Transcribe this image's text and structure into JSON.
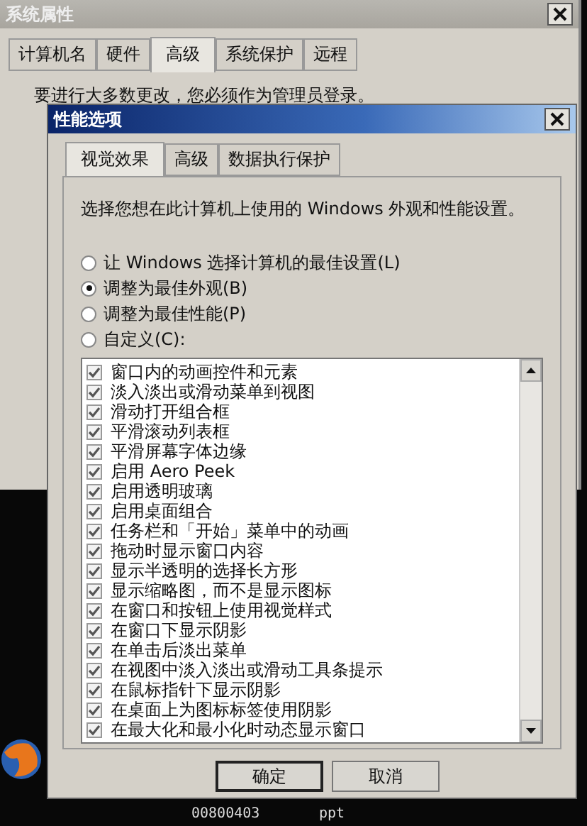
{
  "back_window": {
    "title": "系统属性",
    "tabs": [
      {
        "label": "计算机名",
        "selected": false
      },
      {
        "label": "硬件",
        "selected": false
      },
      {
        "label": "高级",
        "selected": true
      },
      {
        "label": "系统保护",
        "selected": false
      },
      {
        "label": "远程",
        "selected": false
      }
    ],
    "message": "要进行大多数更改，您必须作为管理员登录。"
  },
  "dialog": {
    "title": "性能选项",
    "tabs": [
      {
        "label": "视觉效果",
        "selected": true
      },
      {
        "label": "高级",
        "selected": false
      },
      {
        "label": "数据执行保护",
        "selected": false
      }
    ],
    "description": "选择您想在此计算机上使用的 Windows 外观和性能设置。",
    "options": [
      {
        "label": "让 Windows 选择计算机的最佳设置(L)",
        "selected": false
      },
      {
        "label": "调整为最佳外观(B)",
        "selected": true
      },
      {
        "label": "调整为最佳性能(P)",
        "selected": false
      },
      {
        "label": "自定义(C):",
        "selected": false
      }
    ],
    "effects": [
      {
        "label": "窗口内的动画控件和元素",
        "checked": true
      },
      {
        "label": "淡入淡出或滑动菜单到视图",
        "checked": true
      },
      {
        "label": "滑动打开组合框",
        "checked": true
      },
      {
        "label": "平滑滚动列表框",
        "checked": true
      },
      {
        "label": "平滑屏幕字体边缘",
        "checked": true
      },
      {
        "label": "启用 Aero Peek",
        "checked": true
      },
      {
        "label": "启用透明玻璃",
        "checked": true
      },
      {
        "label": "启用桌面组合",
        "checked": true
      },
      {
        "label": "任务栏和「开始」菜单中的动画",
        "checked": true
      },
      {
        "label": "拖动时显示窗口内容",
        "checked": true
      },
      {
        "label": "显示半透明的选择长方形",
        "checked": true
      },
      {
        "label": "显示缩略图，而不是显示图标",
        "checked": true
      },
      {
        "label": "在窗口和按钮上使用视觉样式",
        "checked": true
      },
      {
        "label": "在窗口下显示阴影",
        "checked": true
      },
      {
        "label": "在单击后淡出菜单",
        "checked": true
      },
      {
        "label": "在视图中淡入淡出或滑动工具条提示",
        "checked": true
      },
      {
        "label": "在鼠标指针下显示阴影",
        "checked": true
      },
      {
        "label": "在桌面上为图标标签使用阴影",
        "checked": true
      },
      {
        "label": "在最大化和最小化时动态显示窗口",
        "checked": true
      }
    ],
    "buttons": [
      "确定",
      "取消"
    ]
  },
  "desktop": {
    "icons": [
      {
        "label": "00800403"
      },
      {
        "label": "ppt"
      }
    ]
  }
}
